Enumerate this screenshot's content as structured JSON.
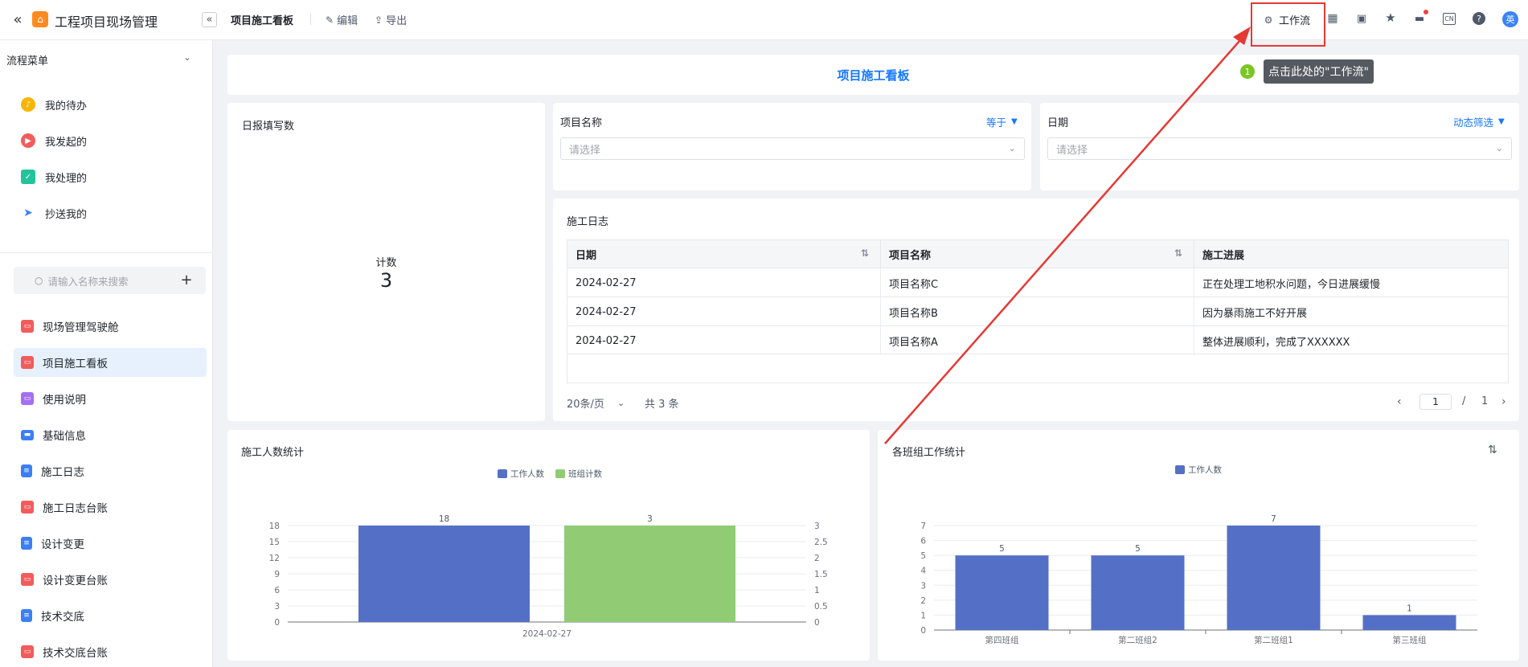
{
  "app": {
    "title": "工程项目现场管理",
    "avatar": "英"
  },
  "header": {
    "page_title": "项目施工看板",
    "edit": "编辑",
    "export": "导出",
    "workflow": "工作流",
    "lang": "CN"
  },
  "sidebar": {
    "flow_menu_title": "流程菜单",
    "flow_items": [
      {
        "label": "我的待办",
        "icon": "bell-icon",
        "color": "#f7b500"
      },
      {
        "label": "我发起的",
        "icon": "play-icon",
        "color": "#f25c5c"
      },
      {
        "label": "我处理的",
        "icon": "check-icon",
        "color": "#23c39b"
      },
      {
        "label": "抄送我的",
        "icon": "send-icon",
        "color": "#3b7ff5"
      }
    ],
    "search_placeholder": "请输入名称来搜索",
    "nav_items": [
      {
        "label": "现场管理驾驶舱",
        "icon": "dashboard-icon",
        "color": "#f25c5c"
      },
      {
        "label": "项目施工看板",
        "icon": "dashboard-icon",
        "color": "#f25c5c"
      },
      {
        "label": "使用说明",
        "icon": "dashboard-icon",
        "color": "#a66ef2"
      },
      {
        "label": "基础信息",
        "icon": "folder-icon",
        "color": "#3b7ff5"
      },
      {
        "label": "施工日志",
        "icon": "doc-icon",
        "color": "#3b7ff5"
      },
      {
        "label": "施工日志台账",
        "icon": "dashboard-icon",
        "color": "#f25c5c"
      },
      {
        "label": "设计变更",
        "icon": "doc-icon",
        "color": "#3b7ff5"
      },
      {
        "label": "设计变更台账",
        "icon": "dashboard-icon",
        "color": "#f25c5c"
      },
      {
        "label": "技术交底",
        "icon": "doc-icon",
        "color": "#3b7ff5"
      },
      {
        "label": "技术交底台账",
        "icon": "dashboard-icon",
        "color": "#f25c5c"
      }
    ]
  },
  "dashboard": {
    "title": "项目施工看板",
    "daily_report": {
      "title": "日报填写数",
      "metric_label": "计数",
      "metric_value": "3"
    },
    "filter_project": {
      "title": "项目名称",
      "mode": "等于",
      "placeholder": "请选择"
    },
    "filter_date": {
      "title": "日期",
      "mode": "动态筛选",
      "placeholder": "请选择"
    },
    "log_table": {
      "title": "施工日志",
      "columns": [
        "日期",
        "项目名称",
        "施工进展"
      ],
      "rows": [
        [
          "2024-02-27",
          "项目名称C",
          "正在处理工地积水问题，今日进展缓慢"
        ],
        [
          "2024-02-27",
          "项目名称B",
          "因为暴雨施工不好开展"
        ],
        [
          "2024-02-27",
          "项目名称A",
          "整体进展顺利，完成了XXXXXX"
        ]
      ],
      "page_size": "20条/页",
      "total": "共 3 条",
      "page": "1",
      "separator": "/",
      "pages": "1"
    }
  },
  "tooltip": {
    "step": "1",
    "text": "点击此处的\"工作流\""
  },
  "colors": {
    "accent": "#1677ff",
    "highlight": "#e53935",
    "bar_blue": "#5470c6",
    "bar_green": "#91cc75"
  },
  "chart_data": [
    {
      "type": "bar",
      "title": "施工人数统计",
      "categories": [
        "2024-02-27"
      ],
      "series": [
        {
          "name": "工作人数",
          "values": [
            18
          ],
          "axis": "left",
          "color": "#5470c6"
        },
        {
          "name": "班组计数",
          "values": [
            3
          ],
          "axis": "right",
          "color": "#91cc75"
        }
      ],
      "ylim_left": [
        0,
        18
      ],
      "yticks_left": [
        "0",
        "3",
        "6",
        "9",
        "12",
        "15",
        "18"
      ],
      "ylim_right": [
        0,
        3
      ],
      "yticks_right": [
        "0",
        "0.5",
        "1",
        "1.5",
        "2",
        "2.5",
        "3"
      ],
      "legend": "top-center",
      "grid": true
    },
    {
      "type": "bar",
      "title": "各班组工作统计",
      "categories": [
        "第四班组",
        "第二班组2",
        "第二班组1",
        "第三班组"
      ],
      "series": [
        {
          "name": "工作人数",
          "values": [
            5,
            5,
            7,
            1
          ],
          "color": "#5470c6"
        }
      ],
      "ylim": [
        0,
        7
      ],
      "yticks": [
        "0",
        "1",
        "2",
        "3",
        "4",
        "5",
        "6",
        "7"
      ],
      "legend": "top-center",
      "grid": true
    }
  ]
}
